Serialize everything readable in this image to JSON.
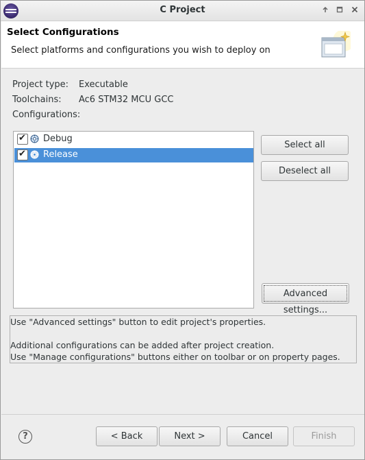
{
  "window": {
    "title": "C Project"
  },
  "banner": {
    "title": "Select Configurations",
    "subtitle": "Select platforms and configurations you wish to deploy on"
  },
  "project": {
    "type_label": "Project type:",
    "type_value": "Executable",
    "toolchains_label": "Toolchains:",
    "toolchains_value": "Ac6 STM32 MCU GCC",
    "configurations_label": "Configurations:"
  },
  "configurations": [
    {
      "label": "Debug",
      "checked": true,
      "selected": false
    },
    {
      "label": "Release",
      "checked": true,
      "selected": true
    }
  ],
  "buttons": {
    "select_all": "Select all",
    "deselect_all": "Deselect all",
    "advanced": "Advanced settings...",
    "back": "< Back",
    "next": "Next >",
    "cancel": "Cancel",
    "finish": "Finish"
  },
  "info": {
    "line1": "Use \"Advanced settings\" button to edit project's properties.",
    "line2": "Additional configurations can be added after project creation.",
    "line3": "Use \"Manage configurations\" buttons either on toolbar or on property pages."
  },
  "colors": {
    "selection": "#4a90d9"
  }
}
